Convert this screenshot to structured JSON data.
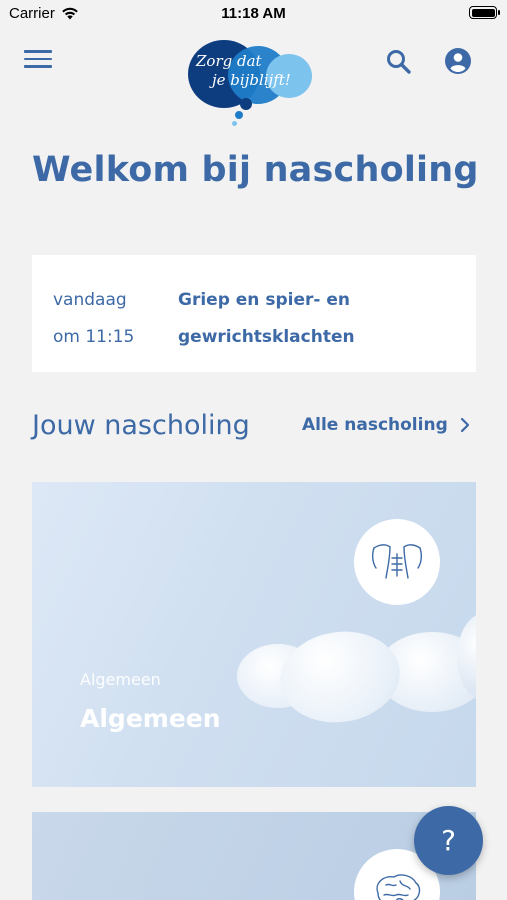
{
  "statusbar": {
    "carrier": "Carrier",
    "time": "11:18 AM",
    "battery_level": 1.0
  },
  "logo": {
    "line1": "Zorg dat",
    "line2": "je bijblijft!"
  },
  "header": {
    "title": "Welkom bij nascholing"
  },
  "today": {
    "day": "vandaag",
    "time": "om 11:15",
    "topic": "Griep en spier- en gewrichtsklachten"
  },
  "section": {
    "title": "Jouw nascholing",
    "all_label": "Alle nascholing"
  },
  "courses": [
    {
      "subtitle": "Algemeen",
      "title": "Algemeen",
      "icon": "torso-icon"
    },
    {
      "subtitle": "",
      "title": "",
      "icon": "brain-icon"
    }
  ],
  "help": {
    "label": "?"
  },
  "colors": {
    "primary": "#3d6aa6",
    "logo_dark": "#0e3d7f",
    "logo_mid": "#1f7cc8",
    "logo_light": "#7cc3ee",
    "background": "#f2f2f2"
  }
}
